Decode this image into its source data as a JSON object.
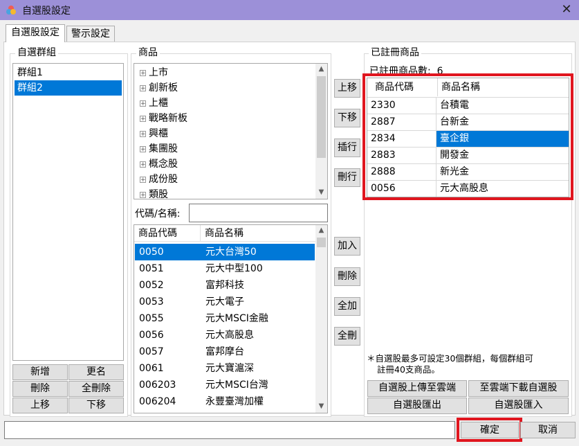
{
  "window": {
    "title": "自選股設定",
    "close_glyph": "✕"
  },
  "tabs": [
    {
      "label": "自選股設定"
    },
    {
      "label": "警示設定"
    }
  ],
  "groups": {
    "label": "自選群組",
    "items": [
      "群組1",
      "群組2"
    ],
    "selected_index": 1,
    "buttons": {
      "add": "新增",
      "rename": "更名",
      "delete": "刪除",
      "delete_all": "全刪除",
      "up": "上移",
      "down": "下移"
    }
  },
  "products": {
    "label": "商品",
    "tree": [
      "上市",
      "創新板",
      "上櫃",
      "戰略新板",
      "興櫃",
      "集團股",
      "概念股",
      "成份股",
      "類股"
    ],
    "search_label": "代碼/名稱:",
    "search_value": "",
    "columns": [
      "商品代碼",
      "商品名稱"
    ],
    "rows": [
      [
        "0050",
        "元大台灣50"
      ],
      [
        "0051",
        "元大中型100"
      ],
      [
        "0052",
        "富邦科技"
      ],
      [
        "0053",
        "元大電子"
      ],
      [
        "0055",
        "元大MSCI金融"
      ],
      [
        "0056",
        "元大高股息"
      ],
      [
        "0057",
        "富邦摩台"
      ],
      [
        "0061",
        "元大寶滬深"
      ],
      [
        "006203",
        "元大MSCI台灣"
      ],
      [
        "006204",
        "永豐臺灣加權"
      ]
    ],
    "selected_index": 0
  },
  "middle_buttons": {
    "up": "上移",
    "down": "下移",
    "insert": "插行",
    "delete_row": "刪行",
    "add": "加入",
    "remove": "刪除",
    "add_all": "全加",
    "remove_all": "全刪"
  },
  "registered": {
    "label": "已註冊商品",
    "count_label": "已註冊商品數:",
    "count": "6",
    "columns": [
      "商品代碼",
      "商品名稱"
    ],
    "rows": [
      [
        "2330",
        "台積電"
      ],
      [
        "2887",
        "台新金"
      ],
      [
        "2834",
        "臺企銀"
      ],
      [
        "2883",
        "開發金"
      ],
      [
        "2888",
        "新光金"
      ],
      [
        "0056",
        "元大高股息"
      ]
    ],
    "selected_index": 2,
    "note_line1": "＊自選股最多可設定30個群組，每個群組可",
    "note_line2": "註冊40支商品。",
    "buttons": {
      "upload": "自選股上傳至雲端",
      "download": "至雲端下載自選股",
      "export": "自選股匯出",
      "import": "自選股匯入"
    }
  },
  "footer": {
    "status_value": "",
    "ok": "確定",
    "cancel": "取消"
  },
  "colors": {
    "selection": "#0078d7",
    "titlebar": "#9c90d8",
    "highlight_box": "#e0161f"
  },
  "icons": [
    "app-logo-icon",
    "close-icon",
    "tree-expand-icon",
    "scroll-up-icon",
    "scroll-down-icon"
  ]
}
